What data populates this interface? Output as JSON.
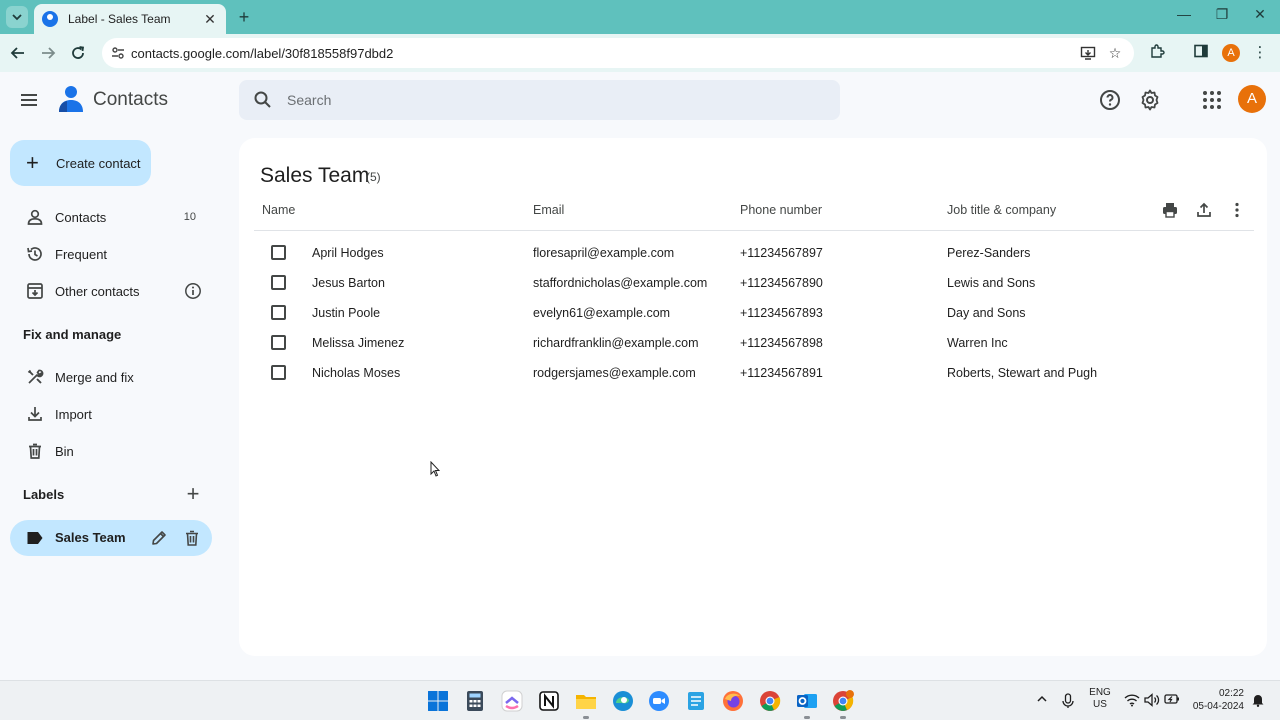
{
  "browser": {
    "tab_title": "Label - Sales Team",
    "url": "contacts.google.com/label/30f818558f97dbd2",
    "profile_initial": "A"
  },
  "app": {
    "name": "Contacts",
    "search_placeholder": "Search",
    "avatar_initial": "A"
  },
  "sidebar": {
    "create_label": "Create contact",
    "items": [
      {
        "label": "Contacts",
        "count": "10",
        "icon": "person-icon"
      },
      {
        "label": "Frequent",
        "icon": "history-icon"
      },
      {
        "label": "Other contacts",
        "icon": "archive-download-icon"
      }
    ],
    "fix_heading": "Fix and manage",
    "fix_items": [
      {
        "label": "Merge and fix",
        "icon": "tools-icon"
      },
      {
        "label": "Import",
        "icon": "download-icon"
      },
      {
        "label": "Bin",
        "icon": "trash-icon"
      }
    ],
    "labels_heading": "Labels",
    "labels": [
      {
        "label": "Sales Team",
        "icon": "label-icon"
      }
    ]
  },
  "main": {
    "title": "Sales Team",
    "count": "(5)",
    "columns": {
      "name": "Name",
      "email": "Email",
      "phone": "Phone number",
      "job": "Job title & company"
    },
    "rows": [
      {
        "name": "April Hodges",
        "email": "floresapril@example.com",
        "phone": "+11234567897",
        "job": "Perez-Sanders"
      },
      {
        "name": "Jesus Barton",
        "email": "staffordnicholas@example.com",
        "phone": "+11234567890",
        "job": "Lewis and Sons"
      },
      {
        "name": "Justin Poole",
        "email": "evelyn61@example.com",
        "phone": "+11234567893",
        "job": "Day and Sons"
      },
      {
        "name": "Melissa Jimenez",
        "email": "richardfranklin@example.com",
        "phone": "+11234567898",
        "job": "Warren Inc"
      },
      {
        "name": "Nicholas Moses",
        "email": "rodgersjames@example.com",
        "phone": "+11234567891",
        "job": "Roberts, Stewart and Pugh"
      }
    ]
  },
  "taskbar": {
    "lang_line1": "ENG",
    "lang_line2": "US",
    "time": "02:22",
    "date": "05-04-2024"
  },
  "colors": {
    "tabbar": "#5fc1bd",
    "accent": "#c2e7ff",
    "brand_blue": "#1a73e8",
    "avatar": "#e8710a"
  }
}
